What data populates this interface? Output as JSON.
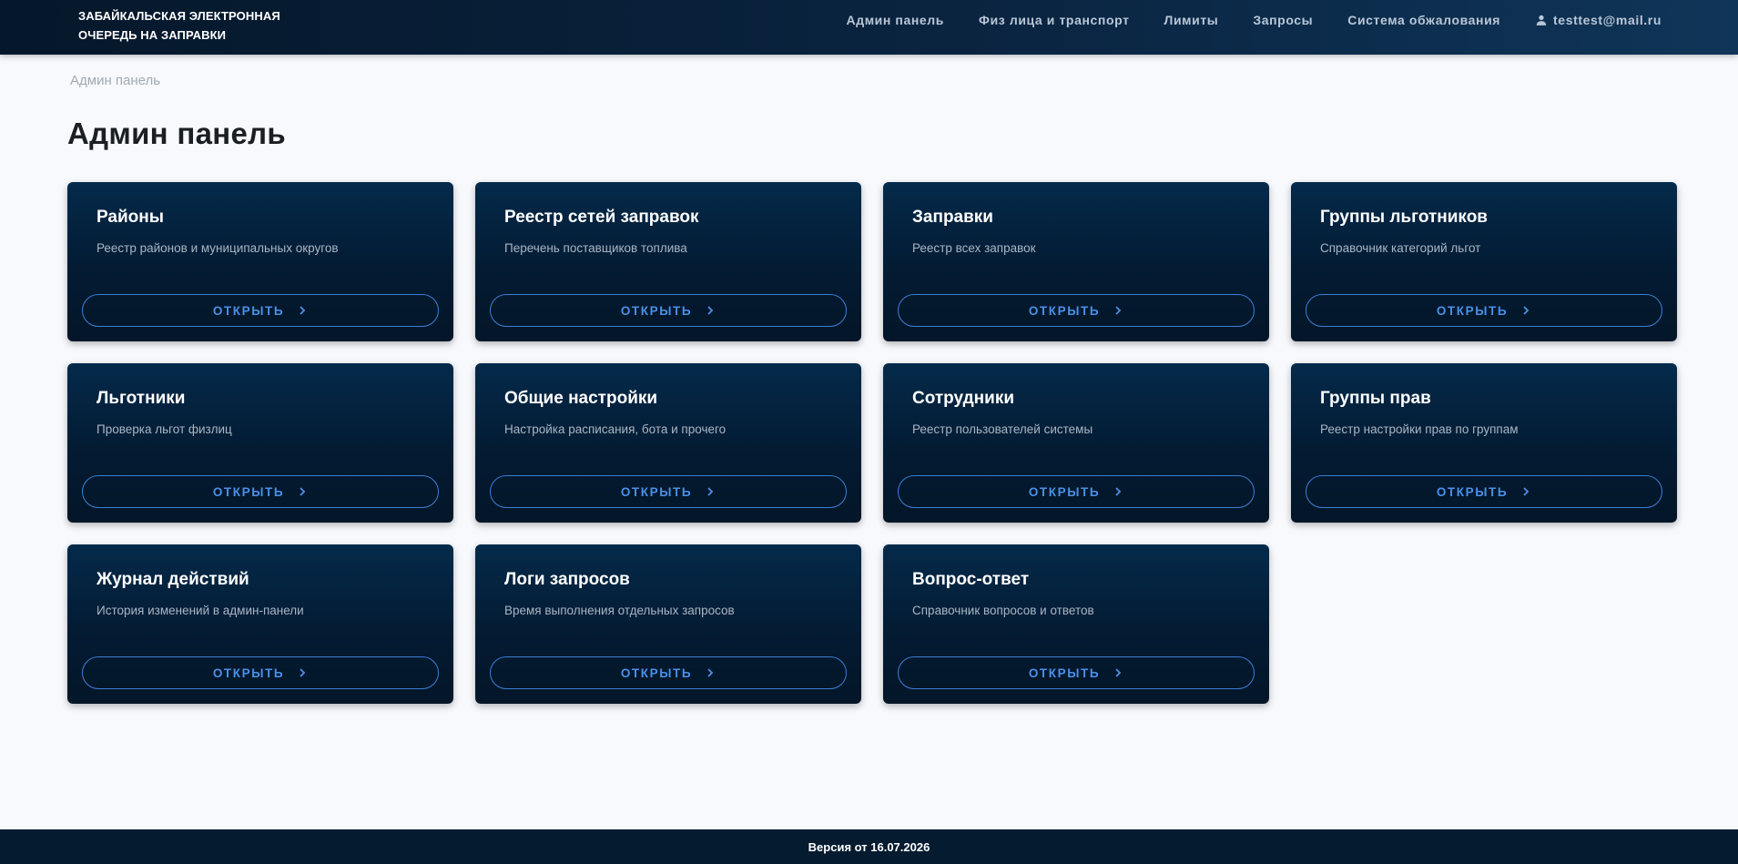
{
  "header": {
    "brand_line1": "ЗАБАЙКАЛЬСКАЯ ЭЛЕКТРОННАЯ",
    "brand_line2": "ОЧЕРЕДЬ НА ЗАПРАВКИ",
    "nav": [
      {
        "label": "Админ панель"
      },
      {
        "label": "Физ лица и транспорт"
      },
      {
        "label": "Лимиты"
      },
      {
        "label": "Запросы"
      },
      {
        "label": "Система обжалования"
      }
    ],
    "user": {
      "email": "testtest@mail.ru",
      "icon": "user-icon"
    }
  },
  "breadcrumb": "Админ панель",
  "page_title": "Админ панель",
  "open_label": "ОТКРЫТЬ",
  "cards": [
    {
      "title": "Районы",
      "desc": "Реестр районов и муниципальных округов"
    },
    {
      "title": "Реестр сетей заправок",
      "desc": "Перечень поставщиков топлива"
    },
    {
      "title": "Заправки",
      "desc": "Реестр всех заправок"
    },
    {
      "title": "Группы льготников",
      "desc": "Справочник категорий льгот"
    },
    {
      "title": "Льготники",
      "desc": "Проверка льгот физлиц"
    },
    {
      "title": "Общие настройки",
      "desc": "Настройка расписания, бота и прочего"
    },
    {
      "title": "Сотрудники",
      "desc": "Реестр пользователей системы"
    },
    {
      "title": "Группы прав",
      "desc": "Реестр настройки прав по группам"
    },
    {
      "title": "Журнал действий",
      "desc": "История изменений в админ-панели"
    },
    {
      "title": "Логи запросов",
      "desc": "Время выполнения отдельных запросов"
    },
    {
      "title": "Вопрос-ответ",
      "desc": "Справочник вопросов и ответов"
    }
  ],
  "footer": {
    "version": "Версия от 16.07.2026"
  },
  "colors": {
    "accent": "#4a90e8",
    "card_bg": "#031b33",
    "header_bg": "#0a2542"
  }
}
